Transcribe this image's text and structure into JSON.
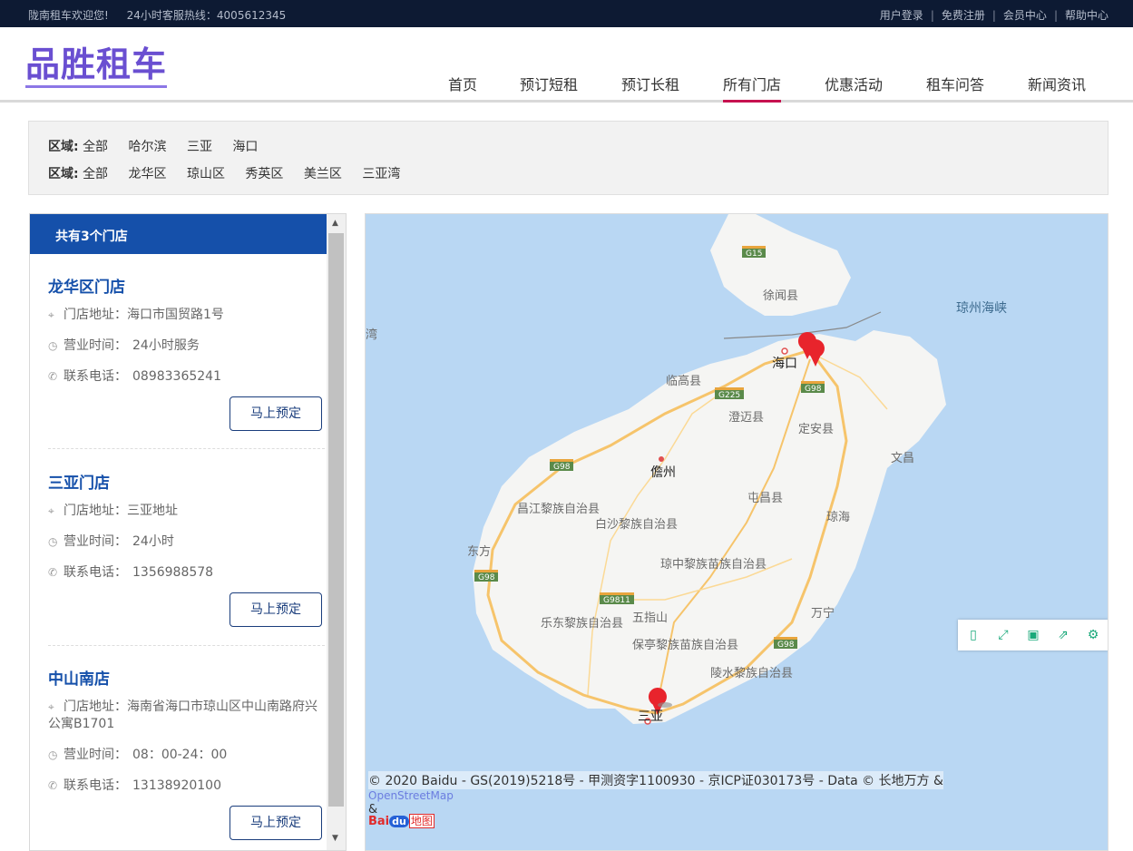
{
  "topbar": {
    "welcome": "陇南租车欢迎您!",
    "hotline": "24小时客服热线：4005612345",
    "links": [
      "用户登录",
      "免费注册",
      "会员中心",
      "帮助中心"
    ]
  },
  "header": {
    "logo": "品胜租车",
    "nav": [
      "首页",
      "预订短租",
      "预订长租",
      "所有门店",
      "优惠活动",
      "租车问答",
      "新闻资讯"
    ],
    "active_nav": "所有门店"
  },
  "filter": {
    "row1": {
      "label": "区域:",
      "options": [
        "全部",
        "哈尔滨",
        "三亚",
        "海口"
      ]
    },
    "row2": {
      "label": "区域:",
      "options": [
        "全部",
        "龙华区",
        "琼山区",
        "秀英区",
        "美兰区",
        "三亚湾"
      ]
    }
  },
  "stores_panel": {
    "header": "共有3个门店",
    "address_label": "门店地址：",
    "hours_label": "营业时间：",
    "phone_label": "联系电话：",
    "book_label": "马上预定",
    "stores": [
      {
        "name": "龙华区门店",
        "address": "海口市国贸路1号",
        "hours": "24小时服务",
        "phone": "08983365241"
      },
      {
        "name": "三亚门店",
        "address": "三亚地址",
        "hours": "24小时",
        "phone": "1356988578"
      },
      {
        "name": "中山南店",
        "address": "海南省海口市琼山区中山南路府兴",
        "address_line2": "公寓B1701",
        "hours": "08：00-24：00",
        "phone": "13138920100"
      }
    ]
  },
  "map": {
    "labels": {
      "xuwen": "徐闻县",
      "strait": "琼州海峡",
      "wan": "湾",
      "haikou": "海口",
      "lingao": "临高县",
      "chengmai": "澄迈县",
      "dingan": "定安县",
      "wenchang": "文昌",
      "danzhou": "儋州",
      "tunchang": "屯昌县",
      "changjiang": "昌江黎族自治县",
      "baisha": "白沙黎族自治县",
      "qionghai": "琼海",
      "dongfang": "东方",
      "qiongzhong": "琼中黎族苗族自治县",
      "ledong": "乐东黎族自治县",
      "wuzhishan": "五指山",
      "wanning": "万宁",
      "baoting": "保亭黎族苗族自治县",
      "lingshui": "陵水黎族自治县",
      "sanya": "三亚"
    },
    "shields": [
      "G15",
      "G225",
      "G98",
      "G98",
      "G98",
      "G9811",
      "G98"
    ],
    "tools": [
      "tablet-icon",
      "fullscreen-icon",
      "save-icon",
      "share-icon",
      "settings-icon"
    ],
    "copyright": "© 2020 Baidu - GS(2019)5218号 - 甲测资字1100930 - 京ICP证030173号 - Data © 长地万方 &",
    "osm": "OpenStreetMap",
    "amp": "&",
    "baidu_logo": {
      "bai": "Bai",
      "du": "du",
      "ditu": "地图"
    },
    "accent_colors": {
      "marker": "#e8242c",
      "sea": "#b9d7f3",
      "land": "#f5f5f3",
      "road": "#f6c46b"
    }
  }
}
